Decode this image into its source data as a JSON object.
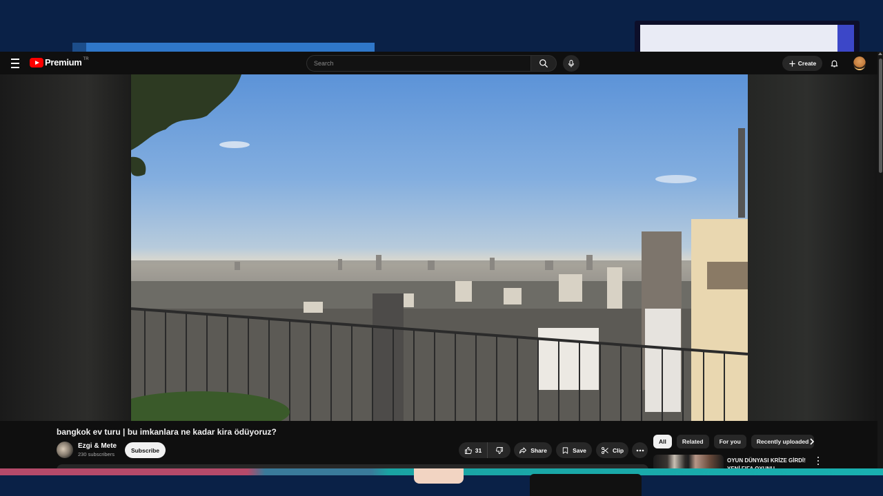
{
  "app": {
    "logo_text": "Premium",
    "logo_country": "TR"
  },
  "masthead": {
    "search_placeholder": "Search",
    "create_label": "Create"
  },
  "video": {
    "title": "bangkok ev turu | bu imkanlara ne kadar kira ödüyoruz?",
    "channel_name": "Ezgi & Mete",
    "subscribers": "230 subscribers",
    "subscribe_label": "Subscribe",
    "like_count": "31",
    "share_label": "Share",
    "save_label": "Save",
    "clip_label": "Clip"
  },
  "chips": [
    "All",
    "Related",
    "For you",
    "Recently uploaded"
  ],
  "recommendation": {
    "title": "OYUN DÜNYASI KRİZE GİRDİ! YENİ FIFA OYUNU DUYURULD..."
  },
  "icons": {
    "menu": "menu-icon",
    "search": "search-icon",
    "mic": "mic-icon",
    "create": "plus-icon",
    "notifications": "bell-icon",
    "like": "thumbs-up-icon",
    "dislike": "thumbs-down-icon",
    "share": "share-icon",
    "save": "bookmark-icon",
    "clip": "scissors-icon",
    "more": "more-icon",
    "chevron": "chevron-right-icon"
  },
  "colors": {
    "brand_red": "#ff0000",
    "page_bg": "#0f0f0f",
    "button_bg": "#272727",
    "desktop_bg": "#0b2450"
  }
}
